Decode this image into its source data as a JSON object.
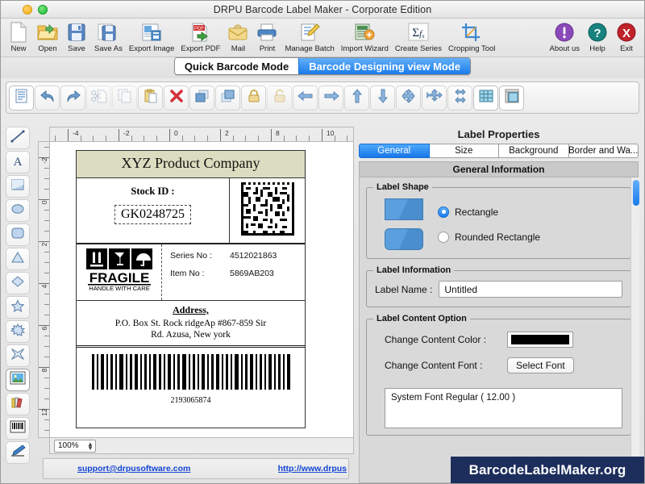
{
  "window": {
    "title": "DRPU Barcode Label Maker - Corporate Edition",
    "minimize_label": "minimize",
    "zoom_label": "zoom"
  },
  "toolbar": {
    "items": [
      {
        "label": "New",
        "icon": "new-document-icon"
      },
      {
        "label": "Open",
        "icon": "open-folder-icon"
      },
      {
        "label": "Save",
        "icon": "floppy-disk-icon"
      },
      {
        "label": "Save As",
        "icon": "save-as-icon"
      },
      {
        "label": "Export Image",
        "icon": "export-image-icon"
      },
      {
        "label": "Export PDF",
        "icon": "export-pdf-icon"
      },
      {
        "label": "Mail",
        "icon": "mail-icon"
      },
      {
        "label": "Print",
        "icon": "printer-icon"
      },
      {
        "label": "Manage Batch",
        "icon": "manage-batch-icon"
      },
      {
        "label": "Import Wizard",
        "icon": "import-wizard-icon"
      },
      {
        "label": "Create Series",
        "icon": "sigma-function-icon"
      },
      {
        "label": "Cropping Tool",
        "icon": "crop-icon"
      }
    ],
    "right_items": [
      {
        "label": "About us",
        "icon": "info-circle-icon",
        "color": "#8a49b8"
      },
      {
        "label": "Help",
        "icon": "question-circle-icon",
        "color": "#17827e"
      },
      {
        "label": "Exit",
        "icon": "close-circle-icon",
        "color": "#c0222a"
      }
    ]
  },
  "mode_tabs": [
    {
      "label": "Quick Barcode Mode",
      "active": false
    },
    {
      "label": "Barcode Designing view Mode",
      "active": true
    }
  ],
  "edit_toolbar": [
    {
      "icon": "new-label-icon",
      "state": "selected"
    },
    {
      "icon": "undo-icon",
      "state": "normal"
    },
    {
      "icon": "redo-icon",
      "state": "normal"
    },
    {
      "icon": "cut-icon",
      "state": "disabled"
    },
    {
      "icon": "copy-icon",
      "state": "disabled"
    },
    {
      "icon": "paste-icon",
      "state": "normal"
    },
    {
      "icon": "delete-icon",
      "state": "normal"
    },
    {
      "icon": "bring-to-front-icon",
      "state": "normal"
    },
    {
      "icon": "send-to-back-icon",
      "state": "normal"
    },
    {
      "icon": "lock-icon",
      "state": "normal"
    },
    {
      "icon": "unlock-icon",
      "state": "disabled"
    },
    {
      "icon": "align-left-icon",
      "state": "normal"
    },
    {
      "icon": "align-right-icon",
      "state": "normal"
    },
    {
      "icon": "align-top-icon",
      "state": "normal"
    },
    {
      "icon": "align-bottom-icon",
      "state": "normal"
    },
    {
      "icon": "align-center-icon",
      "state": "normal"
    },
    {
      "icon": "align-middle-vertical-icon",
      "state": "normal"
    },
    {
      "icon": "align-middle-horizontal-icon",
      "state": "normal"
    },
    {
      "icon": "grid-icon",
      "state": "normal"
    },
    {
      "icon": "page-setup-icon",
      "state": "normal"
    }
  ],
  "tool_palette": [
    {
      "icon": "line-tool-icon",
      "selected": false
    },
    {
      "icon": "text-tool-icon",
      "selected": false
    },
    {
      "icon": "rectangle-tool-icon",
      "selected": false
    },
    {
      "icon": "ellipse-tool-icon",
      "selected": false
    },
    {
      "icon": "rounded-rectangle-tool-icon",
      "selected": false
    },
    {
      "icon": "triangle-tool-icon",
      "selected": false
    },
    {
      "icon": "diamond-tool-icon",
      "selected": false
    },
    {
      "icon": "star-tool-icon",
      "selected": false
    },
    {
      "icon": "burst-tool-icon",
      "selected": false
    },
    {
      "icon": "four-point-star-tool-icon",
      "selected": false
    },
    {
      "icon": "picture-tool-icon",
      "selected": true
    },
    {
      "icon": "library-tool-icon",
      "selected": false
    },
    {
      "icon": "barcode-tool-icon",
      "selected": false
    },
    {
      "icon": "pencil-tool-icon",
      "selected": false
    }
  ],
  "canvas": {
    "ruler_h_labels": [
      "-4",
      "-2",
      "0",
      "2",
      "8",
      "10"
    ],
    "ruler_v_labels": [
      "-2",
      "0",
      "2",
      "4",
      "6",
      "8",
      "12"
    ],
    "zoom_value": "100%"
  },
  "label": {
    "company": "XYZ Product Company",
    "header_bg": "#dcdcc0",
    "stock_id_label": "Stock ID :",
    "stock_id_value": "GK0248725",
    "datamatrix_alt": "datamatrix-barcode",
    "fragile_title": "FRAGILE",
    "fragile_subtitle": "HANDLE WITH CARE",
    "fields": [
      {
        "key": "Series No :",
        "value": "4512021863"
      },
      {
        "key": "Item No :",
        "value": "5869AB203"
      }
    ],
    "address_heading": "Address,",
    "address_line1": "P.O. Box St. Rock ridgeAp #867-859 Sir",
    "address_line2": "Rd. Azusa, New york",
    "barcode_number": "2193065874"
  },
  "footer": {
    "email": "support@drpusoftware.com",
    "website": "http://www.drpus"
  },
  "properties": {
    "title": "Label Properties",
    "tabs": [
      {
        "label": "General",
        "active": true
      },
      {
        "label": "Size",
        "active": false
      },
      {
        "label": "Background",
        "active": false
      },
      {
        "label": "Border and Wa...",
        "active": false
      }
    ],
    "section_header": "General Information",
    "label_shape": {
      "legend": "Label Shape",
      "options": [
        {
          "label": "Rectangle",
          "selected": true
        },
        {
          "label": "Rounded Rectangle",
          "selected": false
        }
      ]
    },
    "label_information": {
      "legend": "Label Information",
      "name_label": "Label Name :",
      "name_value": "Untitled",
      "name_placeholder": "Untitled"
    },
    "label_content_option": {
      "legend": "Label Content Option",
      "color_label": "Change Content Color :",
      "color_value": "#000000",
      "font_label": "Change Content Font :",
      "font_button": "Select Font",
      "font_preview": "System Font Regular ( 12.00 )"
    }
  },
  "watermark": {
    "text": "BarcodeLabelMaker.org",
    "bg": "#1d2e5c"
  }
}
